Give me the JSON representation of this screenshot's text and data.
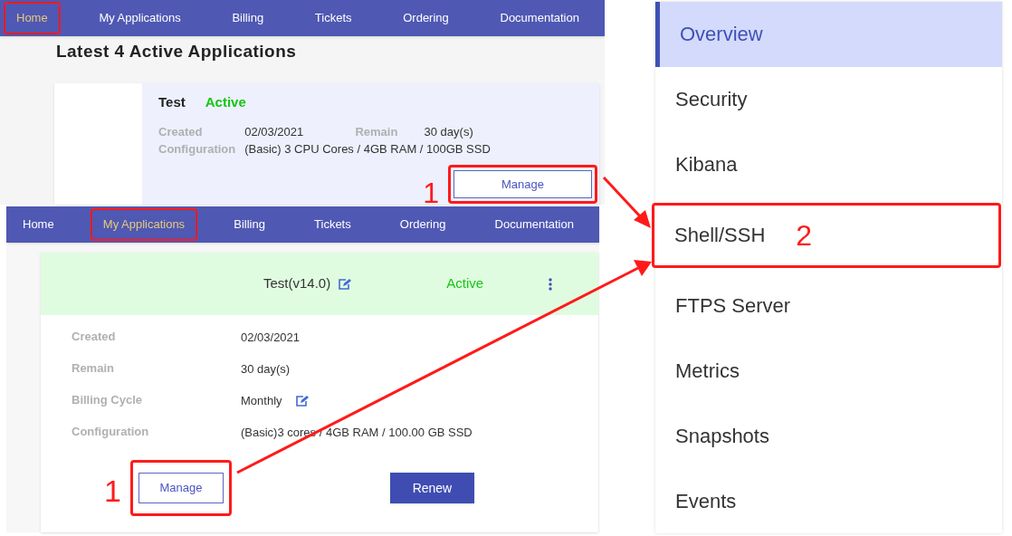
{
  "home_panel": {
    "nav": [
      {
        "label": "Home",
        "selected": true,
        "highlighted": true
      },
      {
        "label": "My Applications",
        "selected": false,
        "highlighted": false
      },
      {
        "label": "Billing",
        "selected": false,
        "highlighted": false
      },
      {
        "label": "Tickets",
        "selected": false,
        "highlighted": false
      },
      {
        "label": "Ordering",
        "selected": false,
        "highlighted": false
      },
      {
        "label": "Documentation",
        "selected": false,
        "highlighted": false
      }
    ],
    "heading": "Latest 4 Active Applications",
    "card": {
      "name": "Test",
      "status": "Active",
      "fields": [
        {
          "label": "Created",
          "value": "02/03/2021"
        },
        {
          "label": "Remain",
          "value": "30 day(s)"
        },
        {
          "label": "Configuration",
          "value": "(Basic) 3 CPU Cores / 4GB RAM / 100GB SSD"
        }
      ],
      "button": {
        "label": "Manage",
        "highlighted": true
      },
      "step": "1"
    }
  },
  "applications_panel": {
    "nav": [
      {
        "label": "Home",
        "selected": false,
        "highlighted": false
      },
      {
        "label": "My Applications",
        "selected": true,
        "highlighted": true
      },
      {
        "label": "Billing",
        "selected": false,
        "highlighted": false
      },
      {
        "label": "Tickets",
        "selected": false,
        "highlighted": false
      },
      {
        "label": "Ordering",
        "selected": false,
        "highlighted": false
      },
      {
        "label": "Documentation",
        "selected": false,
        "highlighted": false
      }
    ],
    "card": {
      "title": "Test(v14.0)",
      "status": "Active",
      "fields": [
        {
          "label": "Created",
          "value": "02/03/2021",
          "editable": false
        },
        {
          "label": "Remain",
          "value": "30 day(s)",
          "editable": false
        },
        {
          "label": "Billing Cycle",
          "value": "Monthly",
          "editable": true
        },
        {
          "label": "Configuration",
          "value": "(Basic)3 cores / 4GB RAM / 100.00 GB SSD",
          "editable": false
        }
      ],
      "buttons": [
        {
          "label": "Manage",
          "kind": "outline",
          "highlighted": true
        },
        {
          "label": "Renew",
          "kind": "filled",
          "highlighted": false
        }
      ],
      "step": "1"
    }
  },
  "menu": {
    "items": [
      {
        "label": "Overview",
        "selected": true,
        "highlighted": false
      },
      {
        "label": "Security",
        "selected": false,
        "highlighted": false
      },
      {
        "label": "Kibana",
        "selected": false,
        "highlighted": false
      },
      {
        "label": "Shell/SSH",
        "selected": false,
        "highlighted": true,
        "step": "2"
      },
      {
        "label": "FTPS Server",
        "selected": false,
        "highlighted": false
      },
      {
        "label": "Metrics",
        "selected": false,
        "highlighted": false
      },
      {
        "label": "Snapshots",
        "selected": false,
        "highlighted": false
      },
      {
        "label": "Events",
        "selected": false,
        "highlighted": false
      }
    ]
  }
}
